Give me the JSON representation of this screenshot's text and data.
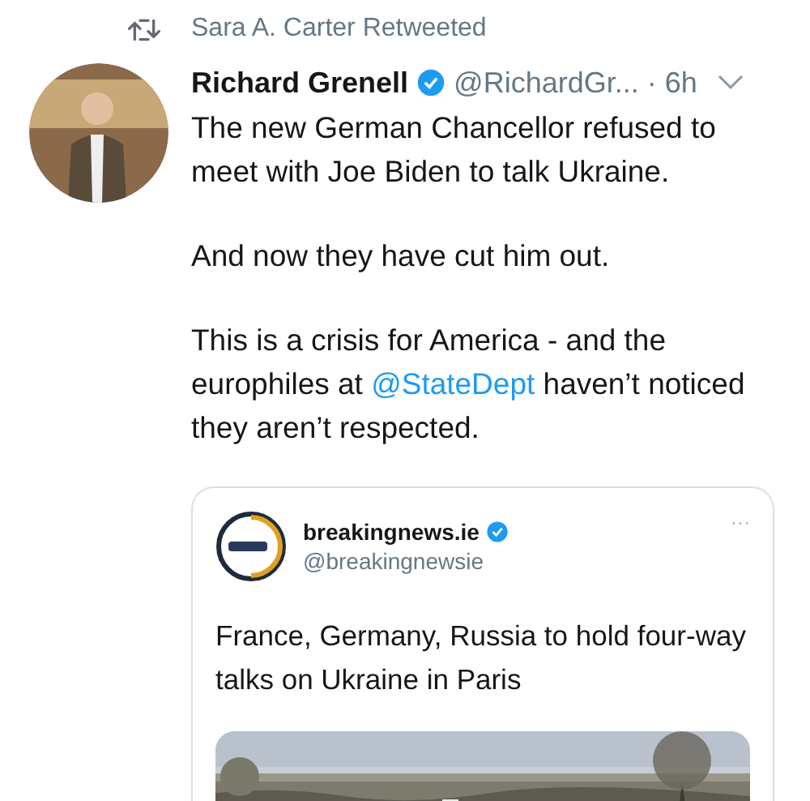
{
  "retweet_label": "Sara A. Carter Retweeted",
  "tweet": {
    "name": "Richard Grenell",
    "verified": true,
    "handle": "@RichardGr...",
    "time": "· 6h",
    "paragraphs": [
      {
        "text": "The new German Chancellor refused to meet with Joe Biden to talk Ukraine."
      },
      {
        "text": "And now they have cut him out."
      },
      {
        "text": "This is a crisis for America - and the europhiles at ",
        "link": "@StateDept",
        "after": " haven’t noticed they aren’t respected."
      }
    ]
  },
  "quote": {
    "name": "breakingnews.ie",
    "verified": true,
    "handle": "@breakingnewsie",
    "more": "···",
    "text": "France, Germany, Russia to hold four-way talks on Ukraine in Paris"
  }
}
